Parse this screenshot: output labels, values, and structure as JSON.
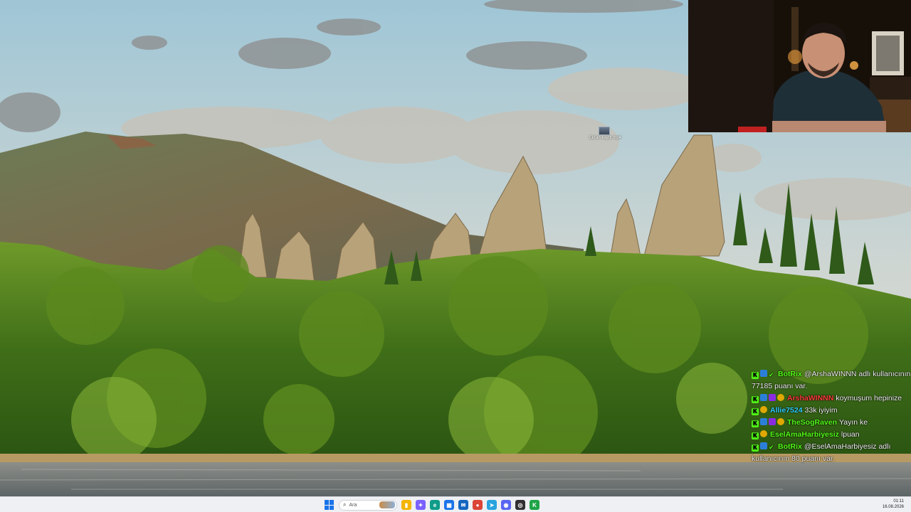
{
  "desktop": {
    "icon_name": "screen-recording-icon",
    "icon_label": "Ekran kaydı.mp4"
  },
  "webcam": {
    "description_name": "streamer-webcam-feed"
  },
  "chat": {
    "messages": [
      {
        "badges": [
          "k",
          "bot",
          "ok"
        ],
        "user": "BotRix",
        "user_color": "#53fc18",
        "text": "@ArshaWINNN adlı kullanıcının 77185 puanı var."
      },
      {
        "badges": [
          "k",
          "bot",
          "vip",
          "sub"
        ],
        "user": "ArshaWINNN",
        "user_color": "#ff3b3b",
        "text": "koymuşum hepinize"
      },
      {
        "badges": [
          "k",
          "sub"
        ],
        "user": "Allie7524",
        "user_color": "#2fd1ff",
        "text": "33k iyiyim"
      },
      {
        "badges": [
          "k",
          "bot",
          "vip",
          "sub"
        ],
        "user": "TheSogRaven",
        "user_color": "#53fc18",
        "text": "Yayın ke"
      },
      {
        "badges": [
          "k",
          "sub"
        ],
        "user": "EselAmaHarbiyesiz",
        "user_color": "#53fc18",
        "text": "lpuan"
      },
      {
        "badges": [
          "k",
          "bot",
          "ok"
        ],
        "user": "BotRix",
        "user_color": "#53fc18",
        "text": "@EselAmaHarbiyesiz adlı kullanıcının 80 puanı var."
      }
    ]
  },
  "taskbar": {
    "search_placeholder": "Ara",
    "apps": [
      {
        "name": "file-explorer-icon",
        "color": "#f4b400",
        "glyph": "▮"
      },
      {
        "name": "copilot-icon",
        "color": "#7b61ff",
        "glyph": "✦"
      },
      {
        "name": "edge-icon",
        "color": "#0f9d8a",
        "glyph": "e"
      },
      {
        "name": "store-icon",
        "color": "#1a73e8",
        "glyph": "▦"
      },
      {
        "name": "mail-icon",
        "color": "#1565c0",
        "glyph": "✉"
      },
      {
        "name": "chrome-icon",
        "color": "#db4437",
        "glyph": "●"
      },
      {
        "name": "telegram-icon",
        "color": "#2aa3de",
        "glyph": "➤"
      },
      {
        "name": "discord-icon",
        "color": "#5865f2",
        "glyph": "◉"
      },
      {
        "name": "obs-icon",
        "color": "#302e31",
        "glyph": "◎"
      },
      {
        "name": "kick-app-icon",
        "color": "#1ea446",
        "glyph": "K"
      }
    ],
    "time": "01:11",
    "date": "16.08.2026"
  }
}
